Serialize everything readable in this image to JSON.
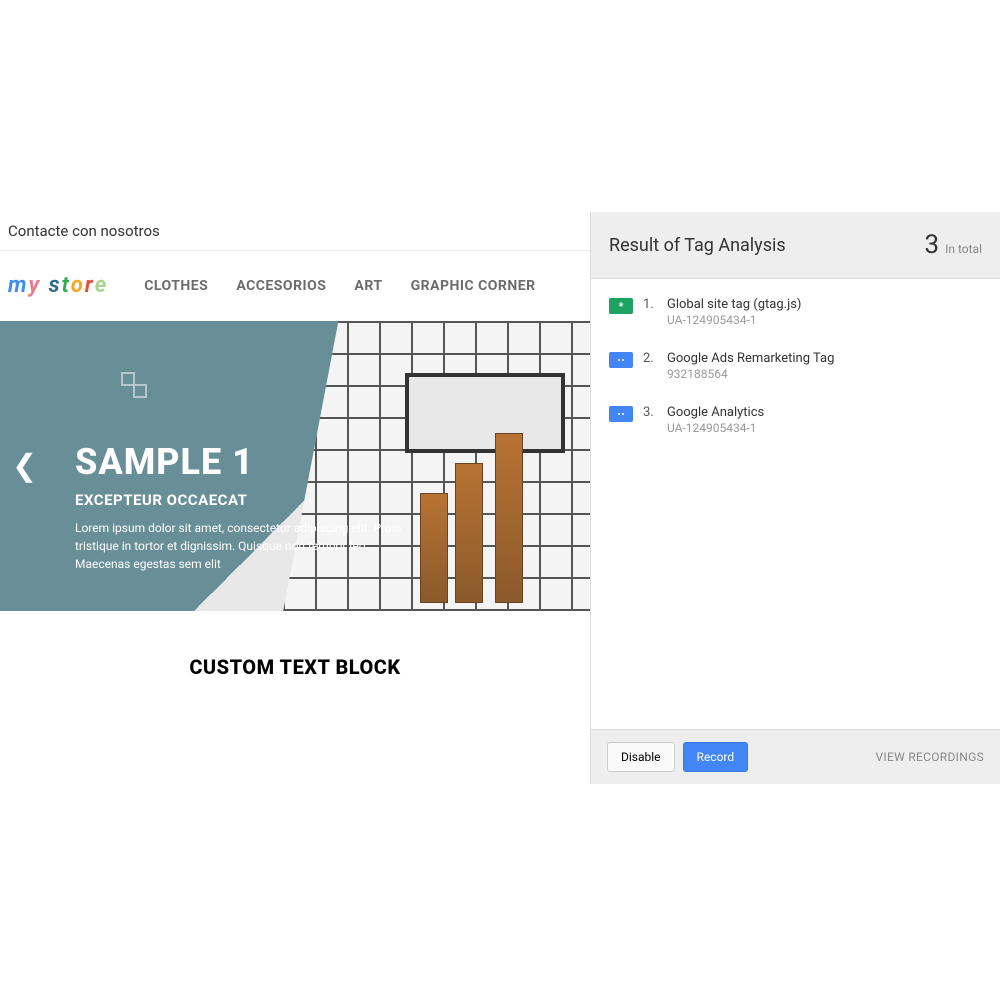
{
  "topbar": {
    "contact": "Contacte con nosotros"
  },
  "logo": {
    "text": "my store"
  },
  "nav": {
    "items": [
      "CLOTHES",
      "ACCESORIOS",
      "ART",
      "GRAPHIC CORNER"
    ]
  },
  "hero": {
    "title": "SAMPLE 1",
    "subtitle": "EXCEPTEUR OCCAECAT",
    "body": "Lorem ipsum dolor sit amet, consectetur adipiscing elit. Proin tristique in tortor et dignissim. Quisque non tempor leo. Maecenas egestas sem elit"
  },
  "custom_block": {
    "title": "CUSTOM TEXT BLOCK"
  },
  "panel": {
    "title": "Result of Tag Analysis",
    "count": "3",
    "count_label": "In total",
    "tags": [
      {
        "num": "1.",
        "name": "Global site tag (gtag.js)",
        "id": "UA-124905434-1",
        "color": "green"
      },
      {
        "num": "2.",
        "name": "Google Ads Remarketing Tag",
        "id": "932188564",
        "color": "blue"
      },
      {
        "num": "3.",
        "name": "Google Analytics",
        "id": "UA-124905434-1",
        "color": "blue"
      }
    ],
    "disable_label": "Disable",
    "record_label": "Record",
    "view_label": "VIEW RECORDINGS"
  }
}
